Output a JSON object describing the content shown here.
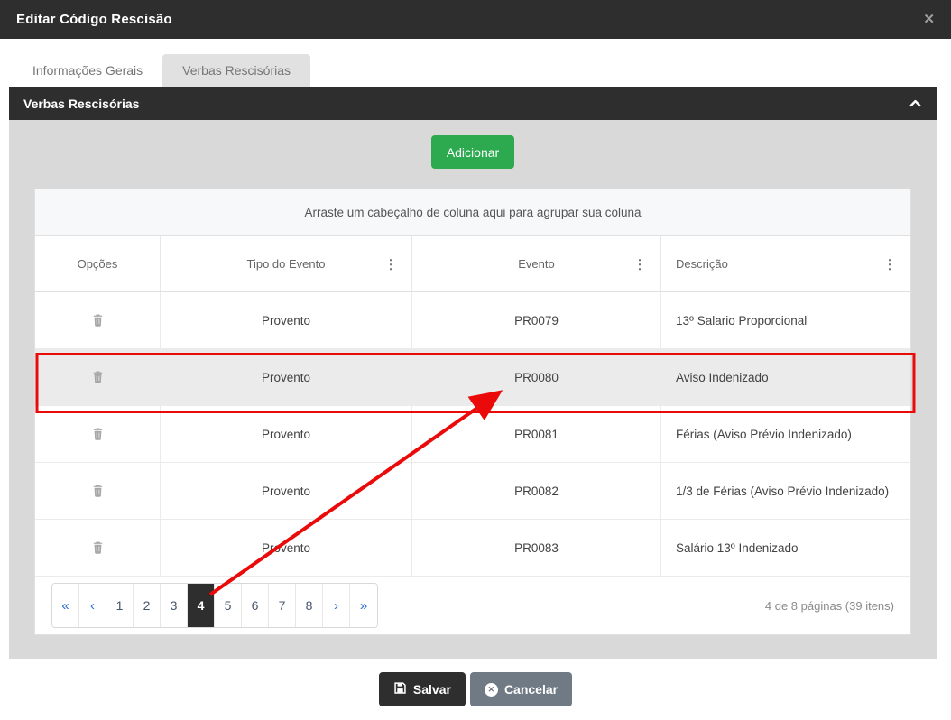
{
  "modal": {
    "title": "Editar Código Rescisão",
    "close_glyph": "✕"
  },
  "tabs": [
    {
      "label": "Informações Gerais",
      "active": false
    },
    {
      "label": "Verbas Rescisórias",
      "active": true
    }
  ],
  "panel": {
    "title": "Verbas Rescisórias",
    "add_button_label": "Adicionar"
  },
  "table": {
    "group_hint": "Arraste um cabeçalho de coluna aqui para agrupar sua coluna",
    "menu_glyph": "⋮",
    "columns": [
      "Opções",
      "Tipo do Evento",
      "Evento",
      "Descrição"
    ],
    "rows": [
      {
        "tipo": "Provento",
        "evento": "PR0079",
        "descricao": "13º Salario Proporcional",
        "highlighted": false
      },
      {
        "tipo": "Provento",
        "evento": "PR0080",
        "descricao": "Aviso Indenizado",
        "highlighted": true
      },
      {
        "tipo": "Provento",
        "evento": "PR0081",
        "descricao": "Férias (Aviso Prévio Indenizado)",
        "highlighted": false
      },
      {
        "tipo": "Provento",
        "evento": "PR0082",
        "descricao": "1/3 de Férias (Aviso Prévio Indenizado)",
        "highlighted": false
      },
      {
        "tipo": "Provento",
        "evento": "PR0083",
        "descricao": "Salário 13º Indenizado",
        "highlighted": false
      }
    ]
  },
  "pager": {
    "first_glyph": "«",
    "prev_glyph": "‹",
    "next_glyph": "›",
    "last_glyph": "»",
    "pages": [
      "1",
      "2",
      "3",
      "4",
      "5",
      "6",
      "7",
      "8"
    ],
    "active_page": "4",
    "info": "4 de 8 páginas (39 itens)"
  },
  "footer": {
    "save_label": "Salvar",
    "cancel_label": "Cancelar",
    "cancel_icon_glyph": "✕"
  },
  "colors": {
    "header_dark": "#2e2e2e",
    "panel_gray": "#d9d9d9",
    "accent_green": "#2daa4f",
    "cancel_gray": "#6f7a85",
    "pager_blue": "#2a6fd3",
    "annotation_red": "#ea0a0a",
    "highlight_row": "#ebebeb"
  }
}
